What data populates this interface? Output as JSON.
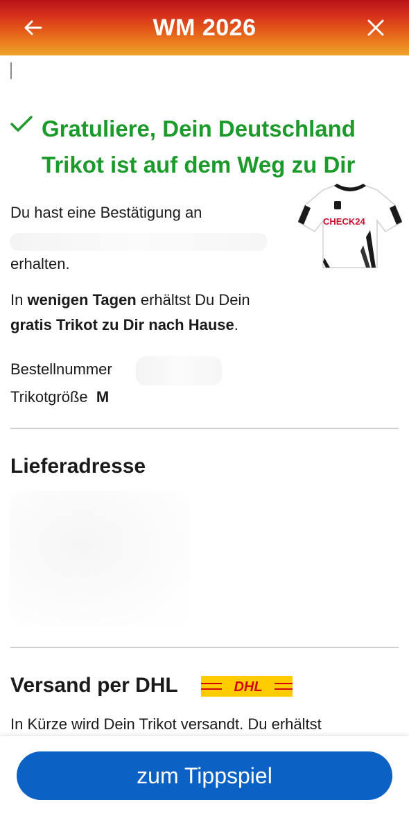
{
  "header": {
    "title": "WM 2026",
    "back_icon": "arrow-left-icon",
    "close_icon": "close-icon"
  },
  "confirmation": {
    "headline_line1": "Gratuliere, Dein Deutschland",
    "headline_line2": "Trikot ist auf dem Weg zu Dir",
    "check_icon": "checkmark-icon",
    "email_text": "Du hast eine Bestätigung an",
    "email_received": "erhalten.",
    "delivery_prefix": "In ",
    "delivery_bold1": "wenigen Tagen",
    "delivery_mid": " erhältst Du Dein",
    "delivery_bold2": "gratis Trikot zu Dir nach Hause",
    "delivery_suffix": ".",
    "order_number_label": "Bestellnummer",
    "size_label": "Trikotgröße",
    "size_value": "M",
    "jersey_brand": "CHECK24"
  },
  "delivery_address": {
    "title": "Lieferadresse"
  },
  "shipping": {
    "title": "Versand per DHL",
    "logo_text": "DHL",
    "text": "In Kürze wird Dein Trikot versandt. Du erhältst"
  },
  "cta": {
    "label": "zum Tippspiel"
  },
  "colors": {
    "accent_green": "#1c9a2b",
    "button_blue": "#0b62c4",
    "dhl_yellow": "#ffcc00",
    "dhl_red": "#d40511"
  }
}
